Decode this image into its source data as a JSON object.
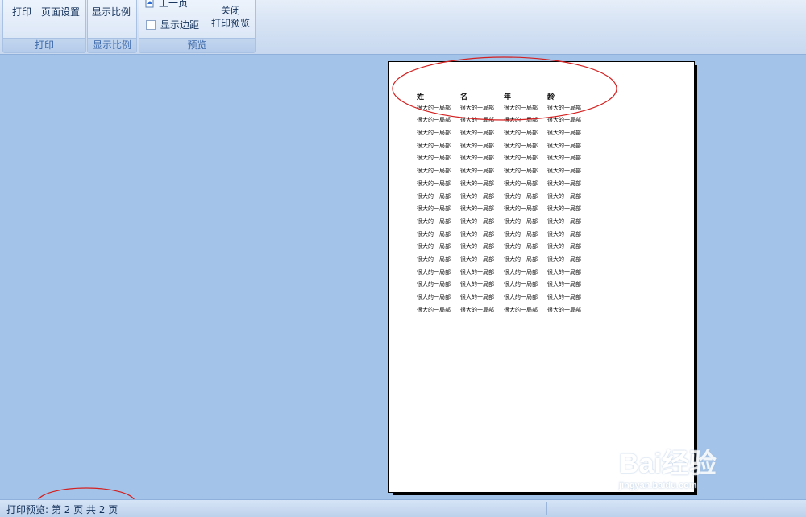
{
  "ribbon": {
    "print_group": {
      "print_label": "打印",
      "page_setup_label": "页面设置",
      "group_label": "打印"
    },
    "zoom_group": {
      "zoom_label": "显示比例",
      "group_label": "显示比例"
    },
    "preview_group": {
      "prev_page_label": "上一页",
      "show_margins_label": "显示边距",
      "show_margins_checked": false,
      "close_line1": "关闭",
      "close_line2": "打印预览",
      "group_label": "预览"
    }
  },
  "page_preview": {
    "headers": [
      "姓",
      "名",
      "年",
      "龄"
    ],
    "row_text": "很大的一局部",
    "row_count": 17
  },
  "status_bar": {
    "text": "打印预览: 第 2 页  共 2 页"
  },
  "watermark": {
    "brand": "Bai经验",
    "sub": "jingyan.baidu.com"
  },
  "colors": {
    "app_background": "#a3c3e8",
    "annotation_red": "#d42020"
  }
}
